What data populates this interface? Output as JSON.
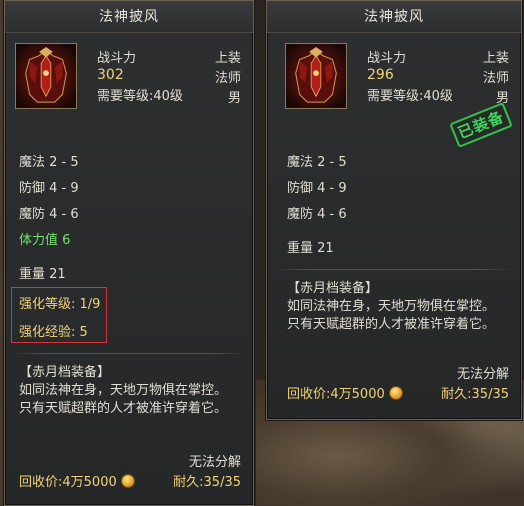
{
  "left": {
    "title": "法神披风",
    "power_label": "战斗力",
    "power_value": "302",
    "requirement": "需要等级:40级",
    "equip_state": "上装",
    "class": "法师",
    "gender": "男",
    "attrs": [
      "魔法 2 - 5",
      "防御 4 - 9",
      "魔防 4 - 6"
    ],
    "stamina": "体力值  6",
    "weight": "重量 21",
    "enhance_level": "强化等级: 1/9",
    "enhance_exp": "强化经验: 5",
    "set_name": "【赤月档装备】",
    "desc_line1": "如同法神在身，天地万物俱在掌控。",
    "desc_line2": "只有天赋超群的人才被准许穿着它。",
    "decompose": "无法分解",
    "recycle": "回收价:4万5000",
    "durability": "耐久:35/35"
  },
  "right": {
    "title": "法神披风",
    "power_label": "战斗力",
    "power_value": "296",
    "requirement": "需要等级:40级",
    "equip_state": "上装",
    "class": "法师",
    "gender": "男",
    "stamp": "已装备",
    "attrs": [
      "魔法 2 - 5",
      "防御 4 - 9",
      "魔防 4 - 6"
    ],
    "weight": "重量 21",
    "set_name": "【赤月档装备】",
    "desc_line1": "如同法神在身，天地万物俱在掌控。",
    "desc_line2": "只有天赋超群的人才被准许穿着它。",
    "decompose": "无法分解",
    "recycle": "回收价:4万5000",
    "durability": "耐久:35/35"
  },
  "colors": {
    "green_stat": "#6fe36a",
    "yellow_text": "#f1d27a",
    "highlight_border": "#d8323a",
    "stamp_green": "#3fd25a"
  }
}
